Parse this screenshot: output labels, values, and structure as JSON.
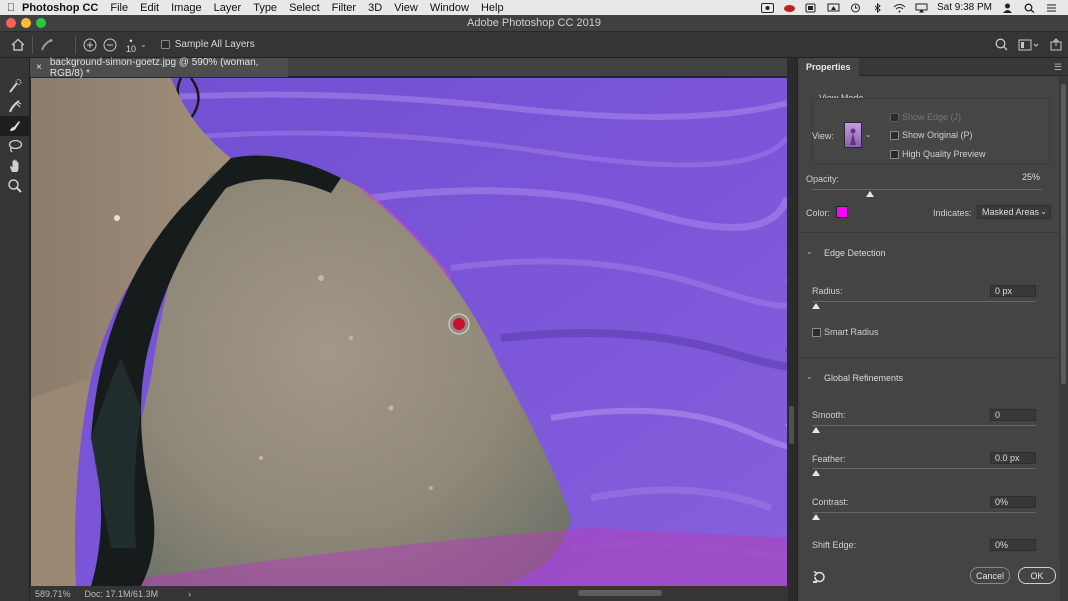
{
  "menubar": {
    "app_name": "Photoshop CC",
    "items": [
      "File",
      "Edit",
      "Image",
      "Layer",
      "Type",
      "Select",
      "Filter",
      "3D",
      "View",
      "Window",
      "Help"
    ],
    "clock": "Sat 9:38 PM"
  },
  "window": {
    "title": "Adobe Photoshop CC 2019"
  },
  "options_bar": {
    "brush_size": "10",
    "sample_all_layers_label": "Sample All Layers"
  },
  "document": {
    "tab_title": "background-simon-goetz.jpg @ 590% (woman, RGB/8) *",
    "tab_close": "×"
  },
  "status_bar": {
    "zoom": "589.71%",
    "doc_size": "Doc: 17.1M/61.3M",
    "arrow": "›"
  },
  "properties": {
    "tab_label": "Properties",
    "view_mode": {
      "title": "View Mode",
      "view_label": "View:",
      "show_edge": "Show Edge (J)",
      "show_original": "Show Original (P)",
      "high_quality_preview": "High Quality Preview"
    },
    "opacity": {
      "label": "Opacity:",
      "value": "25%",
      "level": 0.25
    },
    "color_label": "Color:",
    "color_value": "#ff00ff",
    "indicates": {
      "label": "Indicates:",
      "value": "Masked Areas"
    },
    "edge_detection": {
      "title": "Edge Detection",
      "radius_label": "Radius:",
      "radius_value": "0 px",
      "smart_radius": "Smart Radius"
    },
    "global_refinements": {
      "title": "Global Refinements",
      "smooth_label": "Smooth:",
      "smooth_value": "0",
      "feather_label": "Feather:",
      "feather_value": "0.0 px",
      "contrast_label": "Contrast:",
      "contrast_value": "0%",
      "shift_edge_label": "Shift Edge:",
      "shift_edge_value": "0%"
    },
    "buttons": {
      "cancel": "Cancel",
      "ok": "OK"
    }
  },
  "colors": {
    "accent": "#ff00ff",
    "ui_dark": "#353535",
    "panel": "#444444"
  }
}
